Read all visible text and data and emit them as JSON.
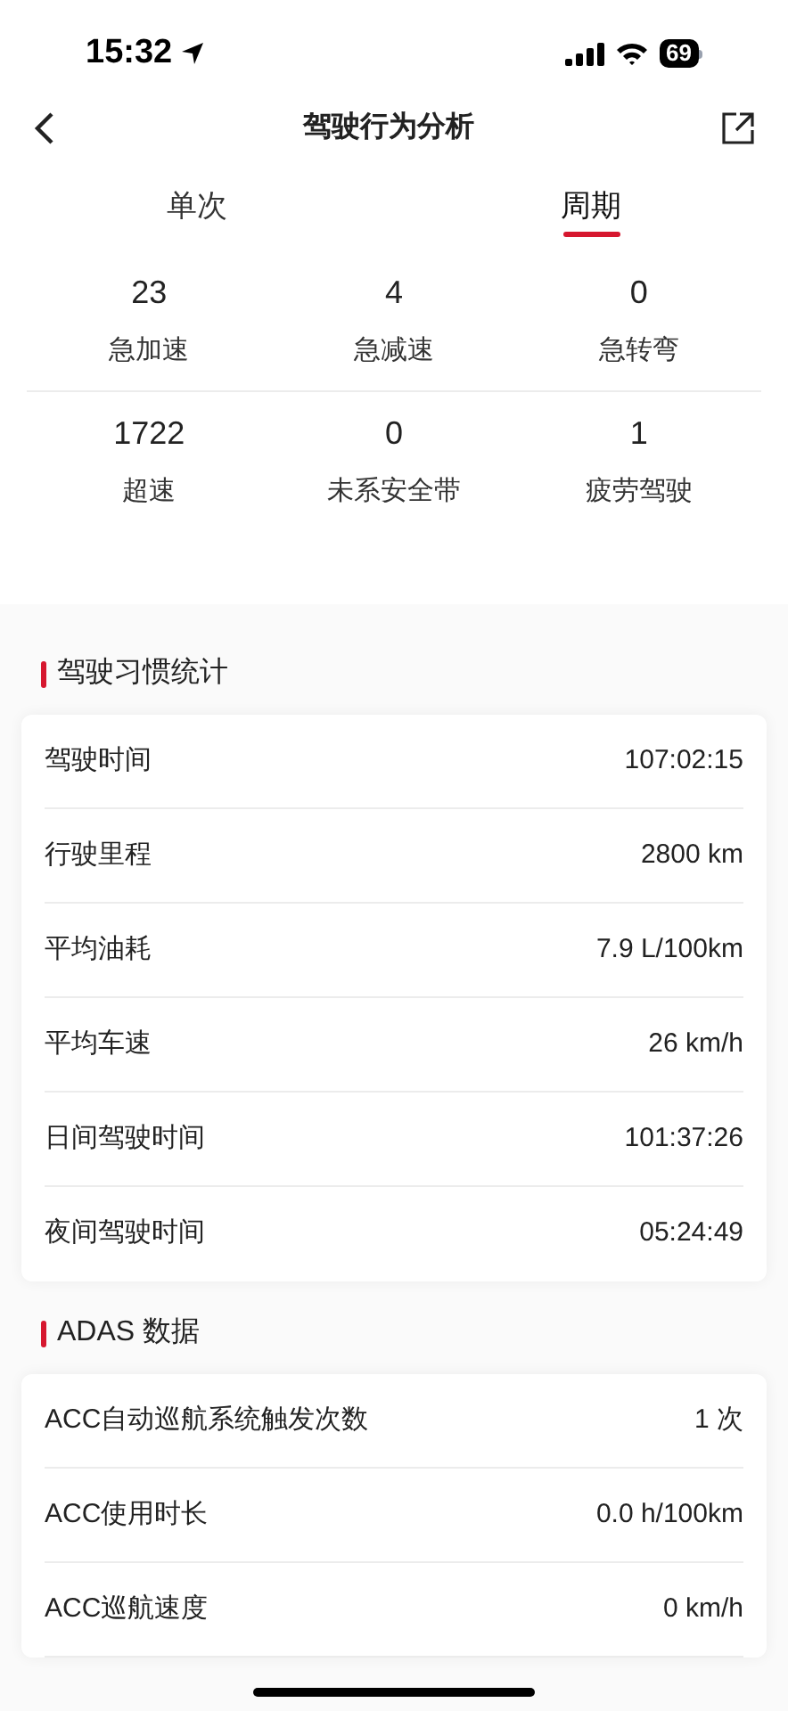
{
  "status_bar": {
    "time": "15:32",
    "battery": "69"
  },
  "nav": {
    "title": "驾驶行为分析"
  },
  "tabs": [
    {
      "label": "单次",
      "selected": false
    },
    {
      "label": "周期",
      "selected": true
    }
  ],
  "stats": [
    {
      "value": "23",
      "label": "急加速"
    },
    {
      "value": "4",
      "label": "急减速"
    },
    {
      "value": "0",
      "label": "急转弯"
    },
    {
      "value": "1722",
      "label": "超速"
    },
    {
      "value": "0",
      "label": "未系安全带"
    },
    {
      "value": "1",
      "label": "疲劳驾驶"
    }
  ],
  "sections": [
    {
      "title": "驾驶习惯统计",
      "rows": [
        {
          "label": "驾驶时间",
          "value": "107:02:15"
        },
        {
          "label": "行驶里程",
          "value": "2800 km"
        },
        {
          "label": "平均油耗",
          "value": "7.9 L/100km"
        },
        {
          "label": "平均车速",
          "value": "26 km/h"
        },
        {
          "label": "日间驾驶时间",
          "value": "101:37:26"
        },
        {
          "label": "夜间驾驶时间",
          "value": "05:24:49"
        }
      ]
    },
    {
      "title": "ADAS 数据",
      "rows": [
        {
          "label": "ACC自动巡航系统触发次数",
          "value": "1 次"
        },
        {
          "label": "ACC使用时长",
          "value": "0.0 h/100km"
        },
        {
          "label": "ACC巡航速度",
          "value": "0 km/h"
        }
      ]
    }
  ]
}
